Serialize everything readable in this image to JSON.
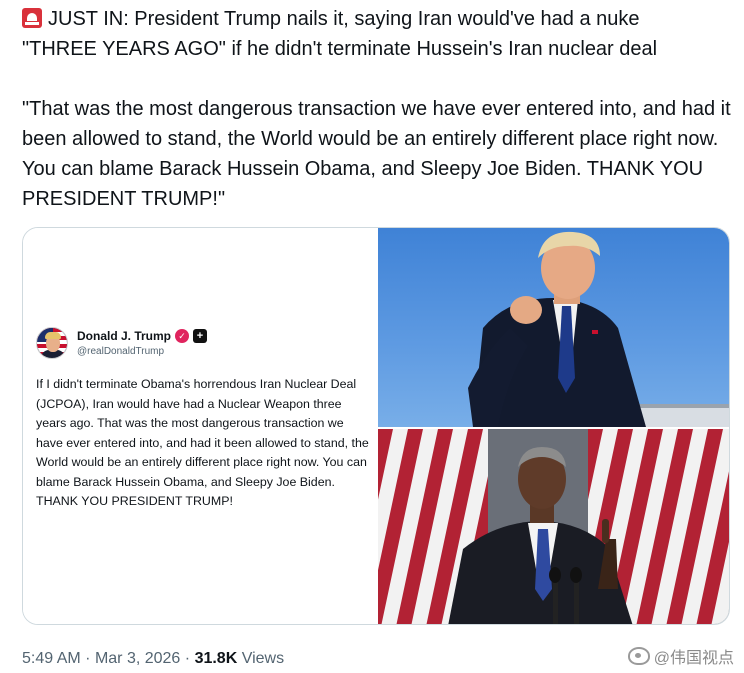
{
  "tweet": {
    "alert_icon": "police-siren-icon",
    "line1": "JUST IN: President Trump nails it, saying Iran would've had a nuke",
    "line2": "\"THREE YEARS AGO\" if he didn't terminate Hussein's Iran nuclear deal",
    "quote": "\"That was the most dangerous transaction we have ever entered into, and had it been allowed to stand, the World would be an entirely different place right now. You can blame Barack Hussein Obama, and Sleepy Joe Biden. THANK YOU PRESIDENT TRUMP!\""
  },
  "truth_post": {
    "display_name": "Donald J. Trump",
    "handle": "@realDonaldTrump",
    "body": "If I didn't terminate Obama's horrendous Iran Nuclear Deal (JCPOA), Iran would have had a Nuclear Weapon three years ago. That was the most dangerous transaction we have ever entered into, and had it been allowed to stand, the World would be an entirely different place right now. You can blame Barack Hussein Obama, and Sleepy Joe Biden. THANK YOU PRESIDENT TRUMP!"
  },
  "meta": {
    "time": "5:49 AM",
    "separator": "·",
    "date": "Mar 3, 2026",
    "views_count": "31.8K",
    "views_label": "Views"
  },
  "watermark": {
    "text": "@伟国视点"
  },
  "colors": {
    "text": "#0f1419",
    "secondary": "#536471",
    "border": "#cfd9de",
    "sky": "#4a8cdb",
    "flag_red": "#b22234"
  }
}
